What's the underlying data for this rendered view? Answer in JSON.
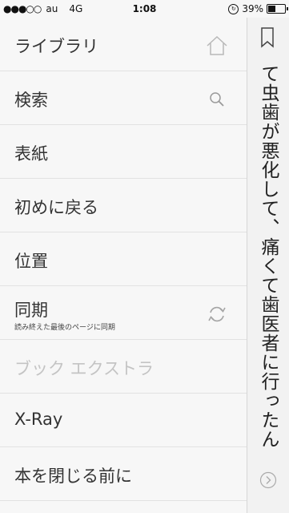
{
  "status_bar": {
    "signal": "●●●○○",
    "carrier": "au",
    "network": "4G",
    "time": "1:08",
    "battery_percent_text": "39%",
    "battery_level": 0.39
  },
  "menu": {
    "items": [
      {
        "label": "ライブラリ",
        "icon": "home-icon"
      },
      {
        "label": "検索",
        "icon": "search-icon"
      },
      {
        "label": "表紙"
      },
      {
        "label": "初めに戻る"
      },
      {
        "label": "位置"
      },
      {
        "label": "同期",
        "sublabel": "読み終えた最後のページに同期",
        "icon": "sync-icon"
      },
      {
        "label": "ブック エクストラ",
        "disabled": true
      },
      {
        "label": "X-Ray"
      },
      {
        "label": "本を閉じる前に"
      }
    ]
  },
  "reader": {
    "text": "て虫歯が悪化して、痛くて歯医者に行ったんですよ",
    "bookmark_icon": "bookmark-icon",
    "next_icon": "chevron-right-icon"
  }
}
